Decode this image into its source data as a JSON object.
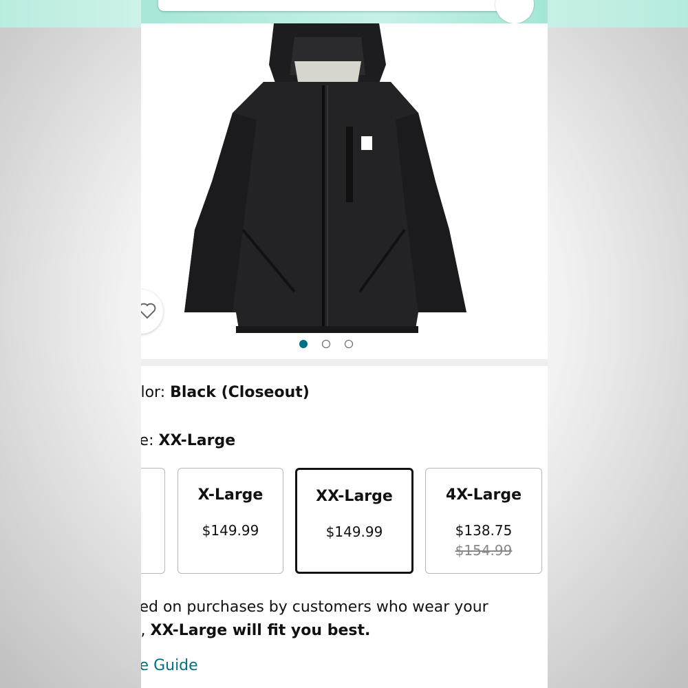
{
  "color": {
    "label": "olor:",
    "value": "Black (Closeout)"
  },
  "size": {
    "label": "ze:",
    "value": "XX-Large"
  },
  "size_options": [
    {
      "name": "",
      "price": ")",
      "old_price": ""
    },
    {
      "name": "X-Large",
      "price": "$149.99",
      "old_price": ""
    },
    {
      "name": "XX-Large",
      "price": "$149.99",
      "old_price": ""
    },
    {
      "name": "4X-Large",
      "price": "$138.75",
      "old_price": "$154.99"
    }
  ],
  "fit": {
    "line1": "sed on purchases by customers who wear your",
    "line2_prefix": "e,",
    "line2_bold": "XX-Large will fit you best."
  },
  "size_guide": "ze Guide",
  "image_dots": {
    "count": 3,
    "active_index": 0
  },
  "colors": {
    "accent": "#007185",
    "selected_border": "#111111"
  },
  "icons": [
    "share-icon",
    "heart-icon",
    "search-bar"
  ]
}
